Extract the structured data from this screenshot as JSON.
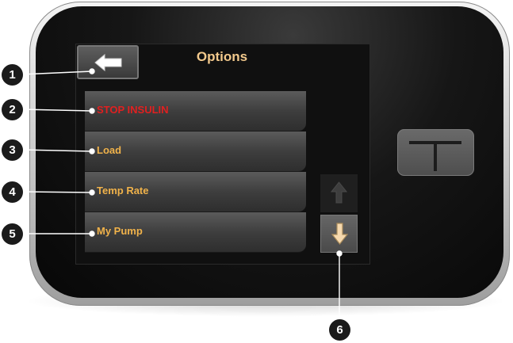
{
  "screen": {
    "title": "Options",
    "back_icon": "left-arrow-icon",
    "menu_items": [
      {
        "label": "STOP INSULIN",
        "color": "#e02020"
      },
      {
        "label": "Load",
        "color": "#f0b24a"
      },
      {
        "label": "Temp Rate",
        "color": "#f0b24a"
      },
      {
        "label": "My Pump",
        "color": "#f0b24a"
      }
    ],
    "scroll_up_icon": "up-arrow-icon",
    "scroll_down_icon": "down-arrow-icon"
  },
  "device": {
    "button_icon": "t-logo-icon"
  },
  "callouts": [
    "1",
    "2",
    "3",
    "4",
    "5",
    "6"
  ],
  "colors": {
    "accent_text": "#f0b24a",
    "warning_text": "#e02020",
    "title_text": "#f2c98c",
    "down_arrow_fill": "#f6d9ae"
  }
}
